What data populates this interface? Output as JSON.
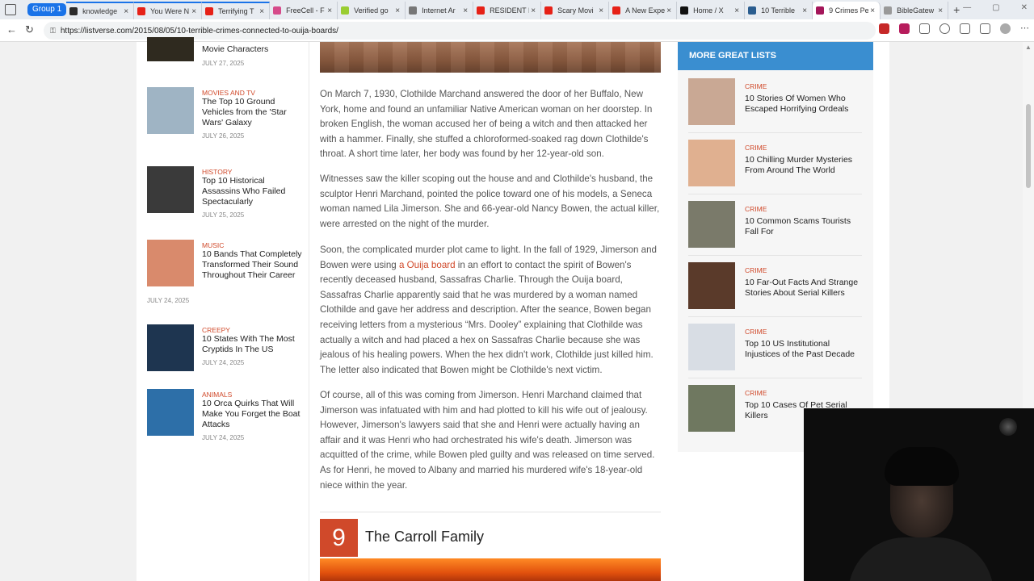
{
  "browser": {
    "group_label": "Group 1",
    "tabs": [
      {
        "title": "knowledge",
        "fav_color": "#2b2b2b",
        "grouped": true
      },
      {
        "title": "You Were N",
        "fav_color": "#e62117",
        "grouped": true
      },
      {
        "title": "Terrifying T",
        "fav_color": "#e62117",
        "grouped": true
      },
      {
        "title": "FreeCell - F",
        "fav_color": "#d64b8a",
        "grouped": false
      },
      {
        "title": "Verified go",
        "fav_color": "#9acd32",
        "grouped": false
      },
      {
        "title": "Internet Ar",
        "fav_color": "#777777",
        "grouped": false
      },
      {
        "title": "RESIDENT E",
        "fav_color": "#e62117",
        "grouped": false
      },
      {
        "title": "Scary Movi",
        "fav_color": "#e62117",
        "grouped": false
      },
      {
        "title": "A New Expe",
        "fav_color": "#e62117",
        "grouped": false
      },
      {
        "title": "Home / X",
        "fav_color": "#111111",
        "grouped": false
      },
      {
        "title": "10 Terrible",
        "fav_color": "#2a5d8f",
        "grouped": false
      },
      {
        "title": "9 Crimes Pe",
        "fav_color": "#a4165a",
        "grouped": false,
        "active": true
      },
      {
        "title": "BibleGatew",
        "fav_color": "#999999",
        "grouped": false
      }
    ],
    "url": "https://listverse.com/2015/08/05/10-terrible-crimes-connected-to-ouija-boards/"
  },
  "left_sidebar": {
    "items": [
      {
        "category": "",
        "title": "Movie Characters",
        "date": "JULY 27, 2025",
        "thumb": "#2f2a1f"
      },
      {
        "category": "MOVIES AND TV",
        "title": "The Top 10 Ground Vehicles from the 'Star Wars' Galaxy",
        "date": "JULY 26, 2025",
        "thumb": "#9fb4c4"
      },
      {
        "category": "HISTORY",
        "title": "Top 10 Historical Assassins Who Failed Spectacularly",
        "date": "JULY 25, 2025",
        "thumb": "#3a3a3a"
      },
      {
        "category": "MUSIC",
        "title": "10 Bands That Completely Transformed Their Sound Throughout Their Career",
        "date": "JULY 24, 2025",
        "thumb": "#d98a6c"
      },
      {
        "category": "CREEPY",
        "title": "10 States With The Most Cryptids In The US",
        "date": "JULY 24, 2025",
        "thumb": "#1e3550"
      },
      {
        "category": "ANIMALS",
        "title": "10 Orca Quirks That Will Make You Forget the Boat Attacks",
        "date": "JULY 24, 2025",
        "thumb": "#2d6fa8"
      }
    ]
  },
  "article": {
    "paragraphs": [
      {
        "text": "On March 7, 1930, Clothilde Marchand answered the door of her Buffalo, New York, home and found an unfamiliar Native American woman on her doorstep. In broken English, the woman accused her of being a witch and then attacked her with a hammer. Finally, she stuffed a chloroformed-soaked rag down Clothilde's throat. A short time later, her body was found by her 12-year-old son."
      },
      {
        "text": "Witnesses saw the killer scoping out the house and and Clothilde's husband, the sculptor Henri Marchand, pointed the police toward one of his models, a Seneca woman named Lila Jimerson. She and 66-year-old Nancy Bowen, the actual killer, were arrested on the night of the murder."
      },
      {
        "before": "Soon, the complicated murder plot came to light. In the fall of 1929, Jimerson and Bowen were using ",
        "link": "a Ouija board",
        "after": " in an effort to contact the spirit of Bowen's recently deceased husband, Sassafras Charlie. Through the Ouija board, Sassafras Charlie apparently said that he was murdered by a woman named Clothilde and gave her address and description. After the seance, Bowen began receiving letters from a mysterious “Mrs. Dooley” explaining that Clothilde was actually a witch and had placed a hex on Sassafras Charlie because she was jealous of his healing powers. When the hex didn't work, Clothilde just killed him. The letter also indicated that Bowen might be Clothilde's next victim."
      },
      {
        "text": "Of course, all of this was coming from Jimerson. Henri Marchand claimed that Jimerson was infatuated with him and had plotted to kill his wife out of jealousy. However, Jimerson's lawyers said that she and Henri were actually having an affair and it was Henri who had orchestrated his wife's death. Jimerson was acquitted of the crime, while Bowen pled guilty and was released on time served. As for Henri, he moved to Albany and married his murdered wife's 18-year-old niece within the year."
      }
    ],
    "section": {
      "number": "9",
      "title": "The Carroll Family"
    }
  },
  "right_sidebar": {
    "heading": "MORE GREAT LISTS",
    "items": [
      {
        "category": "CRIME",
        "title": "10 Stories Of Women Who Escaped Horrifying Ordeals",
        "thumb": "#c9a894"
      },
      {
        "category": "CRIME",
        "title": "10 Chilling Murder Mysteries From Around The World",
        "thumb": "#e0b090"
      },
      {
        "category": "CRIME",
        "title": "10 Common Scams Tourists Fall For",
        "thumb": "#7a7a6a"
      },
      {
        "category": "CRIME",
        "title": "10 Far-Out Facts And Strange Stories About Serial Killers",
        "thumb": "#5a3a2a"
      },
      {
        "category": "CRIME",
        "title": "Top 10 US Institutional Injustices of the Past Decade",
        "thumb": "#d8dde4"
      },
      {
        "category": "CRIME",
        "title": "Top 10 Cases Of Pet Serial Killers",
        "thumb": "#6f7860"
      }
    ]
  }
}
